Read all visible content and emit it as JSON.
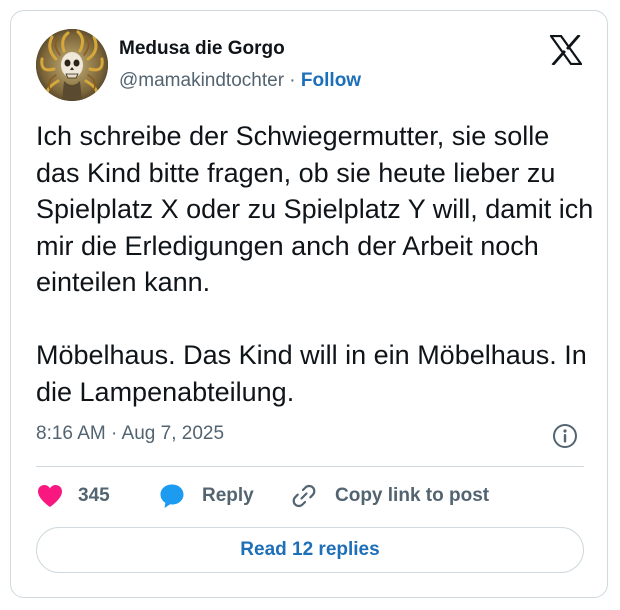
{
  "author": {
    "display_name": "Medusa die Gorgo",
    "handle": "@mamakindtochter",
    "separator": " · ",
    "follow_label": "Follow"
  },
  "tweet": {
    "text": "Ich schreibe der Schwiegermutter, sie solle das Kind bitte fragen, ob sie heute lieber zu Spielplatz X oder zu Spielplatz Y will, damit ich mir die Erledigungen anch der Arbeit noch einteilen kann.\n\nMöbelhaus. Das Kind will in ein Möbelhaus. In die Lampenabteilung.",
    "timestamp": "8:16 AM · Aug 7, 2025"
  },
  "actions": {
    "like_count": "345",
    "reply_label": "Reply",
    "copy_label": "Copy link to post"
  },
  "read_replies_label": "Read 12 replies",
  "icons": {
    "brand": "x-logo-icon",
    "info": "info-icon",
    "like": "heart-icon",
    "reply": "speech-bubble-icon",
    "copy": "link-icon"
  },
  "colors": {
    "text": "#0f1419",
    "secondary": "#536471",
    "link": "#1d6fb8",
    "heart": "#f91880",
    "reply_bubble": "#1d9bf0",
    "border": "#cfd9de"
  }
}
